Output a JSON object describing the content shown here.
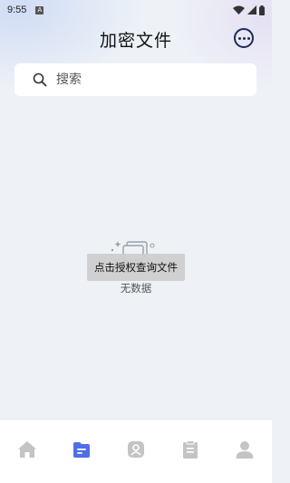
{
  "status_bar": {
    "time": "9:55",
    "notification_badge": "A"
  },
  "header": {
    "title": "加密文件"
  },
  "search": {
    "placeholder": "搜索"
  },
  "empty_state": {
    "text": "无数据"
  },
  "toast": {
    "text": "点击授权查询文件"
  },
  "tabbar": {
    "active_tab": "files",
    "active_color": "#4f6ee8",
    "inactive_color": "#c4c4c4",
    "tabs": [
      {
        "icon": "home-icon"
      },
      {
        "icon": "file-icon"
      },
      {
        "icon": "contact-icon"
      },
      {
        "icon": "clipboard-icon"
      },
      {
        "icon": "profile-icon"
      }
    ]
  }
}
